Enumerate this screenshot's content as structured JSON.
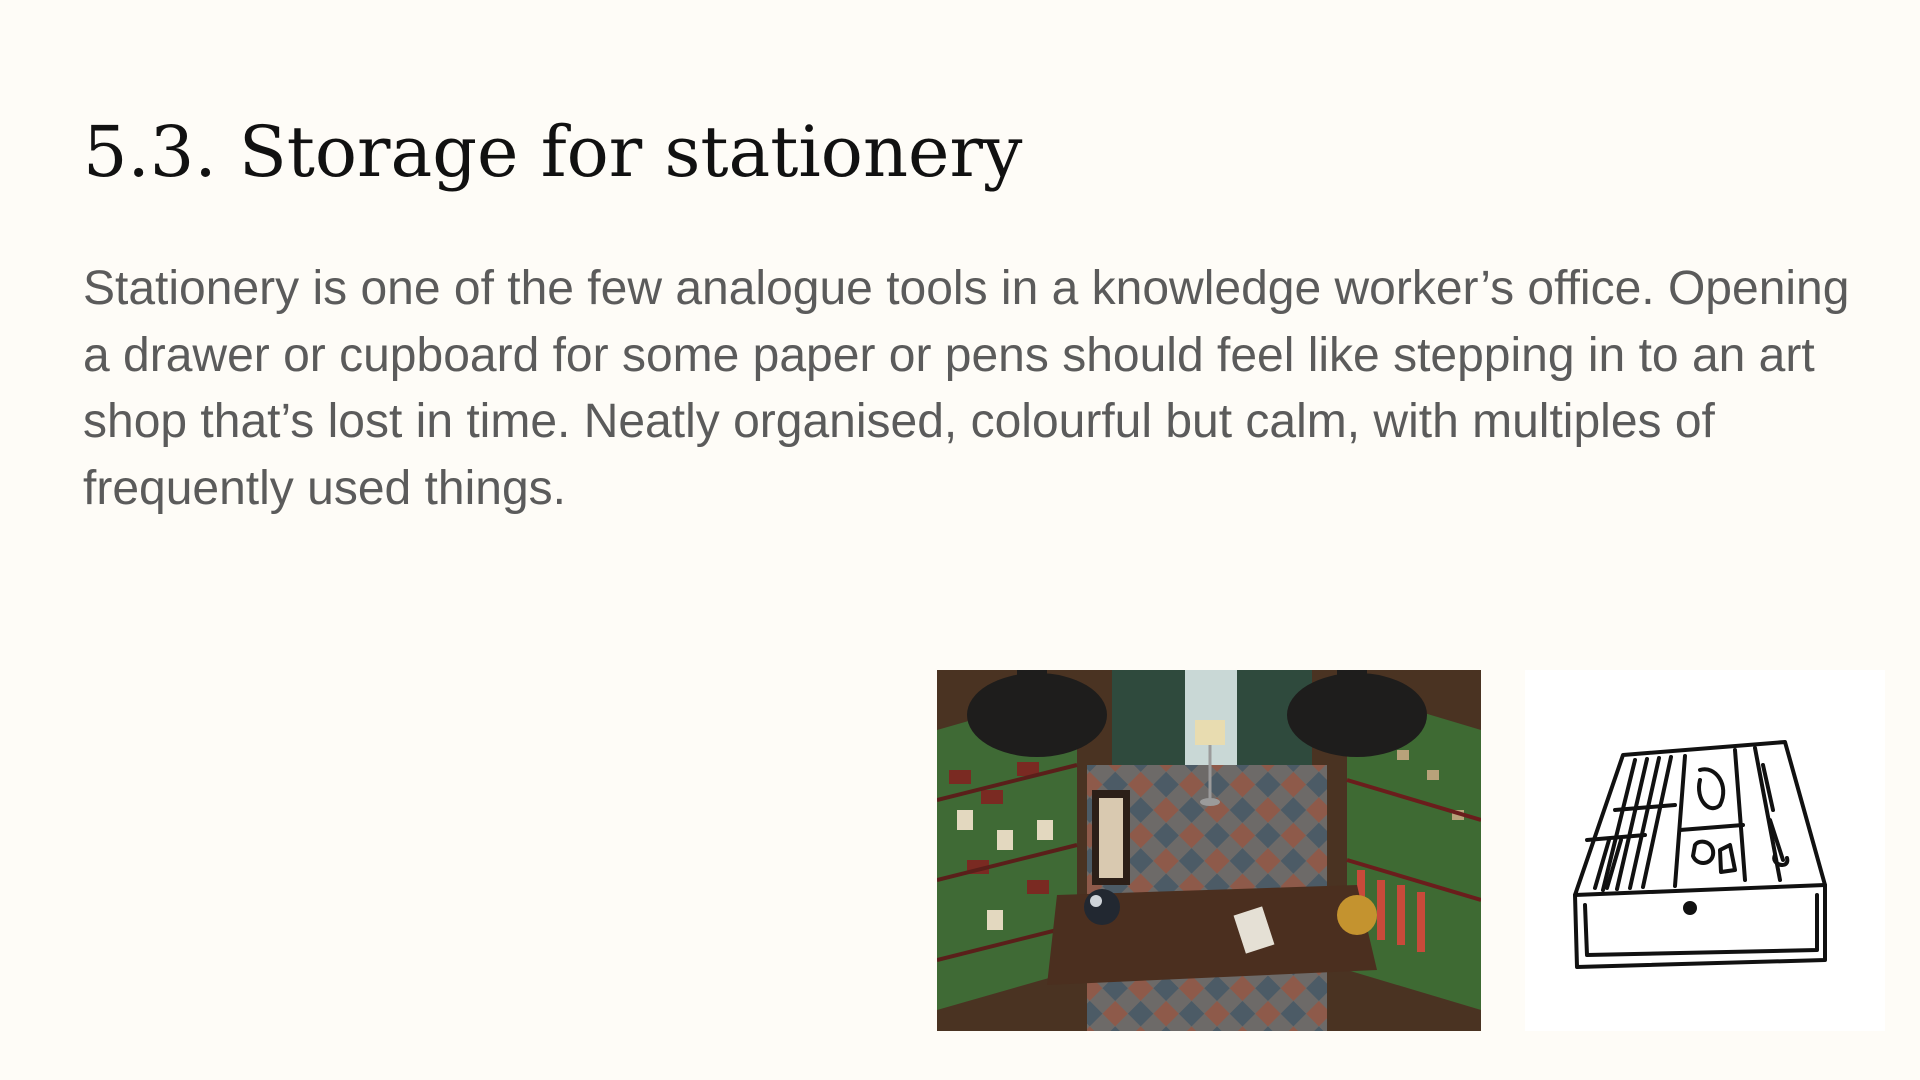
{
  "slide": {
    "title": "5.3. Storage for stationery",
    "body": "Stationery is one of the few analogue tools in a knowledge worker’s office. Opening a drawer or cupboard for some paper or pens should feel like stepping in to an art shop that’s lost in time. Neatly organised, colourful but calm, with multiples of frequently used things."
  },
  "images": {
    "photo": "stationery-shop-interior-photo",
    "sketch": "drawer-organiser-sketch"
  }
}
